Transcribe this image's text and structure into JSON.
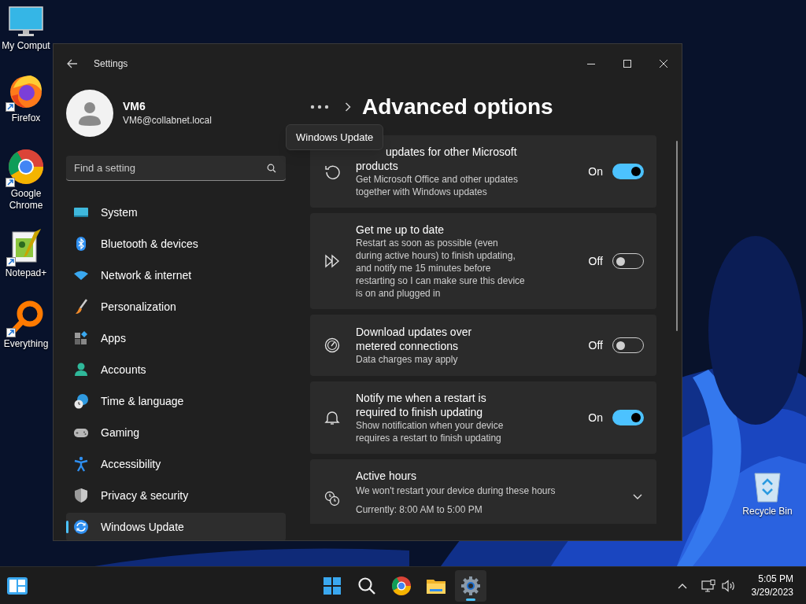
{
  "desktop_icons": [
    {
      "label": "My Comput"
    },
    {
      "label": "Firefox"
    },
    {
      "label": "Google Chrome"
    },
    {
      "label": "Notepad+"
    },
    {
      "label": "Everything"
    },
    {
      "label": "Recycle Bin"
    }
  ],
  "window": {
    "title": "Settings"
  },
  "profile": {
    "name": "VM6",
    "email": "VM6@collabnet.local"
  },
  "search": {
    "placeholder": "Find a setting"
  },
  "nav": [
    {
      "label": "System",
      "selected": false
    },
    {
      "label": "Bluetooth & devices",
      "selected": false
    },
    {
      "label": "Network & internet",
      "selected": false
    },
    {
      "label": "Personalization",
      "selected": false
    },
    {
      "label": "Apps",
      "selected": false
    },
    {
      "label": "Accounts",
      "selected": false
    },
    {
      "label": "Time & language",
      "selected": false
    },
    {
      "label": "Gaming",
      "selected": false
    },
    {
      "label": "Accessibility",
      "selected": false
    },
    {
      "label": "Privacy & security",
      "selected": false
    },
    {
      "label": "Windows Update",
      "selected": true
    }
  ],
  "page_title": "Advanced options",
  "tooltip": "Windows Update",
  "settings": [
    {
      "kind": "toggle",
      "title": "updates for other Microsoft products",
      "description": "Get Microsoft Office and other updates together with Windows updates",
      "state_label": "On",
      "on": true
    },
    {
      "kind": "toggle",
      "title": "Get me up to date",
      "description": "Restart as soon as possible (even during active hours) to finish updating, and notify me 15 minutes before restarting so I can make sure this device is on and plugged in",
      "state_label": "Off",
      "on": false
    },
    {
      "kind": "toggle",
      "title": "Download updates over metered connections",
      "description": "Data charges may apply",
      "state_label": "Off",
      "on": false
    },
    {
      "kind": "toggle",
      "title": "Notify me when a restart is required to finish updating",
      "description": "Show notification when your device requires a restart to finish updating",
      "state_label": "On",
      "on": true
    },
    {
      "kind": "expander",
      "title": "Active hours",
      "description": "We won't restart your device during these hours",
      "detail": "Currently: 8:00 AM to 5:00 PM",
      "expanded": false
    }
  ],
  "taskbar": {
    "apps": [
      {
        "kind": "start",
        "selected": false
      },
      {
        "kind": "search",
        "selected": false
      },
      {
        "kind": "chrome",
        "selected": false
      },
      {
        "kind": "explorer",
        "selected": false
      },
      {
        "kind": "settings",
        "selected": true
      }
    ],
    "time": "5:05 PM",
    "date": "3/29/2023"
  }
}
